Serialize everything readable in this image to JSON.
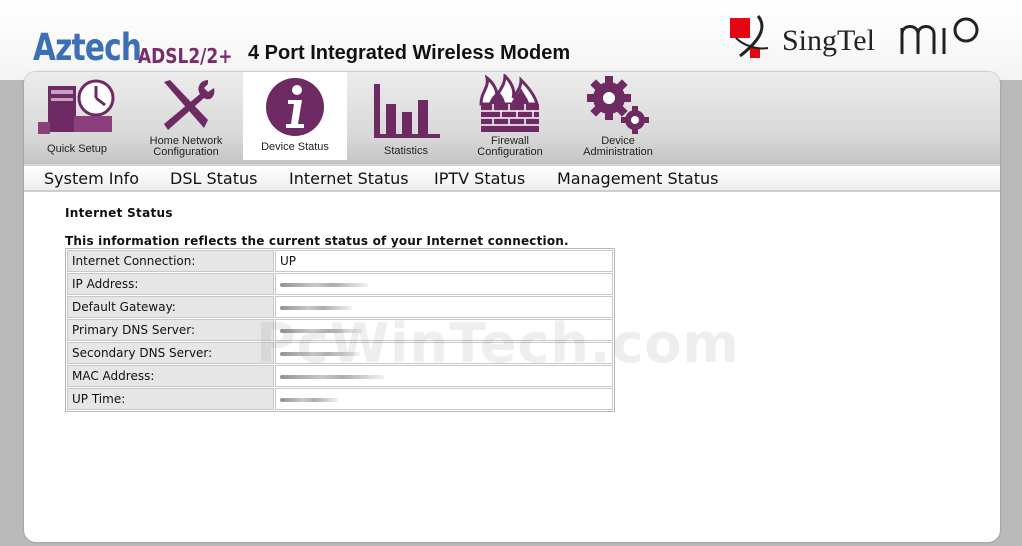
{
  "header": {
    "brand": "Aztech",
    "model": "ADSL2/2+",
    "product_title": "4 Port Integrated Wireless Modem",
    "partner": "SingTel",
    "partner_sub": "mio"
  },
  "nav": {
    "items": [
      {
        "label1": "Quick Setup",
        "label2": "",
        "icon": "computer-clock-icon"
      },
      {
        "label1": "Home Network",
        "label2": "Configuration",
        "icon": "tools-icon"
      },
      {
        "label1": "Device Status",
        "label2": "",
        "icon": "info-icon"
      },
      {
        "label1": "Statistics",
        "label2": "",
        "icon": "bar-chart-icon"
      },
      {
        "label1": "Firewall",
        "label2": "Configuration",
        "icon": "firewall-icon"
      },
      {
        "label1": "Device",
        "label2": "Administration",
        "icon": "gears-icon"
      }
    ],
    "active_index": 2
  },
  "subnav": {
    "items": [
      "System Info",
      "DSL Status",
      "Internet Status",
      "IPTV Status",
      "Management Status"
    ]
  },
  "content": {
    "title": "Internet Status",
    "description": "This information reflects the current status of your Internet connection.",
    "rows": [
      {
        "label": "Internet Connection:",
        "value": "UP"
      },
      {
        "label": "IP Address:",
        "value": ""
      },
      {
        "label": "Default Gateway:",
        "value": ""
      },
      {
        "label": "Primary DNS Server:",
        "value": ""
      },
      {
        "label": "Secondary DNS Server:",
        "value": ""
      },
      {
        "label": "MAC Address:",
        "value": ""
      },
      {
        "label": "UP Time:",
        "value": ""
      }
    ]
  },
  "watermark": "PcWinTech.com",
  "colors": {
    "brand_blue": "#3b6fb6",
    "icon_purple": "#6e2a63",
    "singtel_red": "#e30613"
  }
}
